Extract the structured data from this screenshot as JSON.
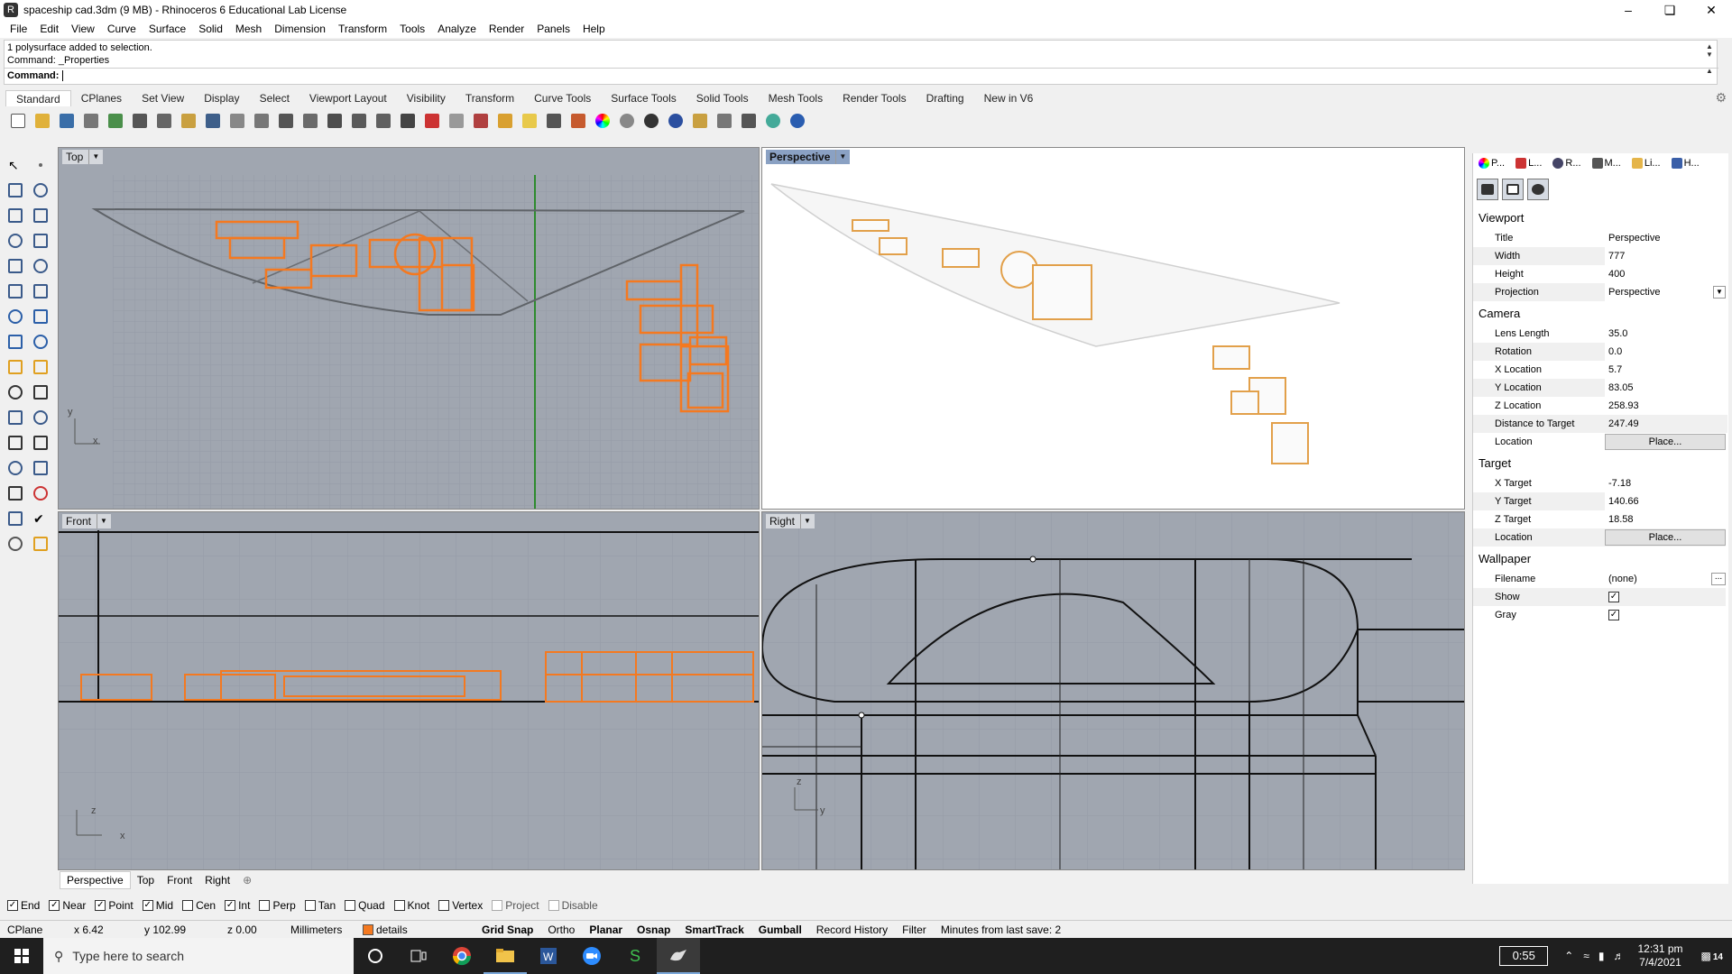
{
  "window": {
    "title": "spaceship cad.3dm (9 MB) - Rhinoceros 6 Educational Lab License",
    "app_icon": "rhino-icon"
  },
  "menu": [
    "File",
    "Edit",
    "View",
    "Curve",
    "Surface",
    "Solid",
    "Mesh",
    "Dimension",
    "Transform",
    "Tools",
    "Analyze",
    "Render",
    "Panels",
    "Help"
  ],
  "command": {
    "history": [
      "1 polysurface added to selection.",
      "Command: _Properties"
    ],
    "prompt": "Command:"
  },
  "toolbar_tabs": [
    "Standard",
    "CPlanes",
    "Set View",
    "Display",
    "Select",
    "Viewport Layout",
    "Visibility",
    "Transform",
    "Curve Tools",
    "Surface Tools",
    "Solid Tools",
    "Mesh Tools",
    "Render Tools",
    "Drafting",
    "New in V6"
  ],
  "toolbar_icons": [
    "new-icon",
    "open-icon",
    "save-icon",
    "print-icon",
    "import-icon",
    "cut-icon",
    "copy-icon",
    "paste-icon",
    "undo-icon",
    "pan-icon",
    "rotate-view-icon",
    "zoom-window-icon",
    "zoom-dynamic-icon",
    "zoom-extents-icon",
    "zoom-selected-icon",
    "zoom-all-icon",
    "four-viewports-icon",
    "car-icon",
    "plane-icon",
    "cplane-icon",
    "point-icon",
    "light-icon",
    "lock-icon",
    "materials-icon",
    "color-wheel-icon",
    "sphere-gray-icon",
    "sphere-render-icon",
    "sphere-blue-icon",
    "dimension-icon",
    "gear-icon",
    "extents-icon",
    "render-icon",
    "help-icon"
  ],
  "viewports": {
    "top": {
      "label": "Top"
    },
    "perspective": {
      "label": "Perspective"
    },
    "front": {
      "label": "Front"
    },
    "right": {
      "label": "Right"
    }
  },
  "viewport_tabs": [
    "Perspective",
    "Top",
    "Front",
    "Right"
  ],
  "panel": {
    "tabs": [
      "P...",
      "L...",
      "R...",
      "M...",
      "Li...",
      "H..."
    ],
    "sections": {
      "viewport": {
        "heading": "Viewport",
        "rows": [
          {
            "k": "Title",
            "v": "Perspective"
          },
          {
            "k": "Width",
            "v": "777"
          },
          {
            "k": "Height",
            "v": "400"
          },
          {
            "k": "Projection",
            "v": "Perspective"
          }
        ]
      },
      "camera": {
        "heading": "Camera",
        "rows": [
          {
            "k": "Lens Length",
            "v": "35.0"
          },
          {
            "k": "Rotation",
            "v": "0.0"
          },
          {
            "k": "X Location",
            "v": "5.7"
          },
          {
            "k": "Y Location",
            "v": "83.05"
          },
          {
            "k": "Z Location",
            "v": "258.93"
          },
          {
            "k": "Distance to Target",
            "v": "247.49"
          },
          {
            "k": "Location",
            "v": "Place..."
          }
        ]
      },
      "target": {
        "heading": "Target",
        "rows": [
          {
            "k": "X Target",
            "v": "-7.18"
          },
          {
            "k": "Y Target",
            "v": "140.66"
          },
          {
            "k": "Z Target",
            "v": "18.58"
          },
          {
            "k": "Location",
            "v": "Place..."
          }
        ]
      },
      "wallpaper": {
        "heading": "Wallpaper",
        "rows": [
          {
            "k": "Filename",
            "v": "(none)"
          },
          {
            "k": "Show",
            "v": ""
          },
          {
            "k": "Gray",
            "v": ""
          }
        ]
      }
    }
  },
  "osnap": [
    {
      "label": "End",
      "checked": true
    },
    {
      "label": "Near",
      "checked": true
    },
    {
      "label": "Point",
      "checked": true
    },
    {
      "label": "Mid",
      "checked": true
    },
    {
      "label": "Cen",
      "checked": false
    },
    {
      "label": "Int",
      "checked": true
    },
    {
      "label": "Perp",
      "checked": false
    },
    {
      "label": "Tan",
      "checked": false
    },
    {
      "label": "Quad",
      "checked": false
    },
    {
      "label": "Knot",
      "checked": false
    },
    {
      "label": "Vertex",
      "checked": false
    },
    {
      "label": "Project",
      "checked": false
    },
    {
      "label": "Disable",
      "checked": false
    }
  ],
  "status": {
    "cplane": "CPlane",
    "x": "x 6.42",
    "y": "y 102.99",
    "z": "z 0.00",
    "units": "Millimeters",
    "layer": "details",
    "layer_color": "#f47920",
    "toggles": [
      "Grid Snap",
      "Ortho",
      "Planar",
      "Osnap",
      "SmartTrack",
      "Gumball",
      "Record History",
      "Filter"
    ],
    "save_msg": "Minutes from last save: 2"
  },
  "taskbar": {
    "search_placeholder": "Type here to search",
    "timer": "0:55",
    "time": "12:31 pm",
    "date": "7/4/2021",
    "notifications": "14"
  },
  "colors": {
    "accent_orange": "#f47920",
    "viewport_bg": "#a0a6b0",
    "active_label": "#8aa1c3"
  }
}
